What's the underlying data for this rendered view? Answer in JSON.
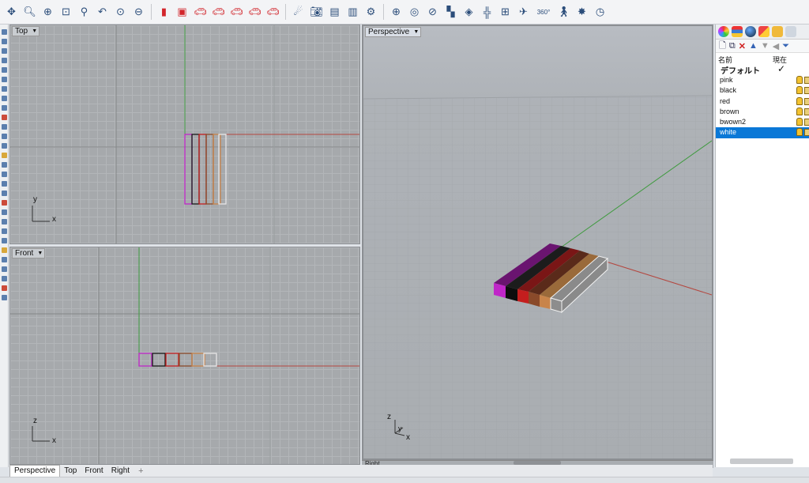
{
  "toolbar": {
    "icons": [
      "orbit-icon",
      "zoom-icon",
      "zoom-window-icon",
      "zoom-extents-icon",
      "zoom-selected-icon",
      "undo-view-icon",
      "zoom-dynamic-icon",
      "zoom-out-icon",
      "display-mode-icon",
      "car-render-icon-1",
      "car-render-icon-2",
      "car-render-icon-3",
      "car-render-icon-4",
      "car-render-icon-5",
      "car-render-icon-6",
      "light-icon",
      "camera-icon",
      "save-view-icon",
      "restore-view-icon",
      "capture-icon",
      "target-icon",
      "focus-icon",
      "snap-icon",
      "plane-icon",
      "cplane-icon",
      "cplane-world-icon",
      "walkabout-icon",
      "turntable-icon",
      "rotate-360-icon",
      "walk-icon",
      "sun-icon",
      "clock-icon"
    ],
    "label_360": "360°"
  },
  "viewports": {
    "top": {
      "label": "Top"
    },
    "front": {
      "label": "Front"
    },
    "perspective": {
      "label": "Perspective"
    },
    "right": {
      "label": "Right"
    }
  },
  "axes": {
    "x": "x",
    "y": "y",
    "z": "z"
  },
  "tabs": [
    "Perspective",
    "Top",
    "Front",
    "Right"
  ],
  "tab_add": "+",
  "layers": {
    "col_name": "名前",
    "col_current": "現在",
    "default_layer": "デフォルト",
    "default_check": "✓",
    "items": [
      {
        "name": "pink",
        "color": "#c026c8"
      },
      {
        "name": "black",
        "color": "#1a1a1a"
      },
      {
        "name": "red",
        "color": "#c41e1e"
      },
      {
        "name": "brown",
        "color": "#8a4a2a"
      },
      {
        "name": "bwown2",
        "color": "#c8844a"
      },
      {
        "name": "white",
        "color": "#e0e0e0",
        "selected": true
      }
    ]
  },
  "colors": {
    "x_axis": "#b4473f",
    "y_axis": "#3f9a3f",
    "selection": "#0a78d7"
  }
}
